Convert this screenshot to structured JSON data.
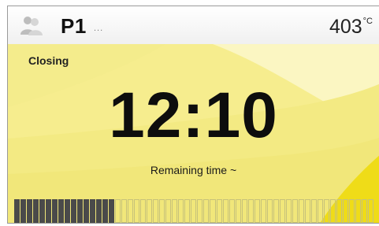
{
  "header": {
    "program": "P1",
    "dots": "...",
    "temperature": "403",
    "temperature_unit": "°C"
  },
  "main": {
    "status": "Closing",
    "timer": "12:10",
    "remaining_label": "Remaining time ~"
  },
  "progress": {
    "segments_total": 57,
    "segments_filled": 16
  },
  "colors": {
    "background": "#f6ed8e",
    "accent_yellow": "#f2e100",
    "segment_fill": "#4a4a4a"
  },
  "icons": {
    "user": "user-icon"
  }
}
